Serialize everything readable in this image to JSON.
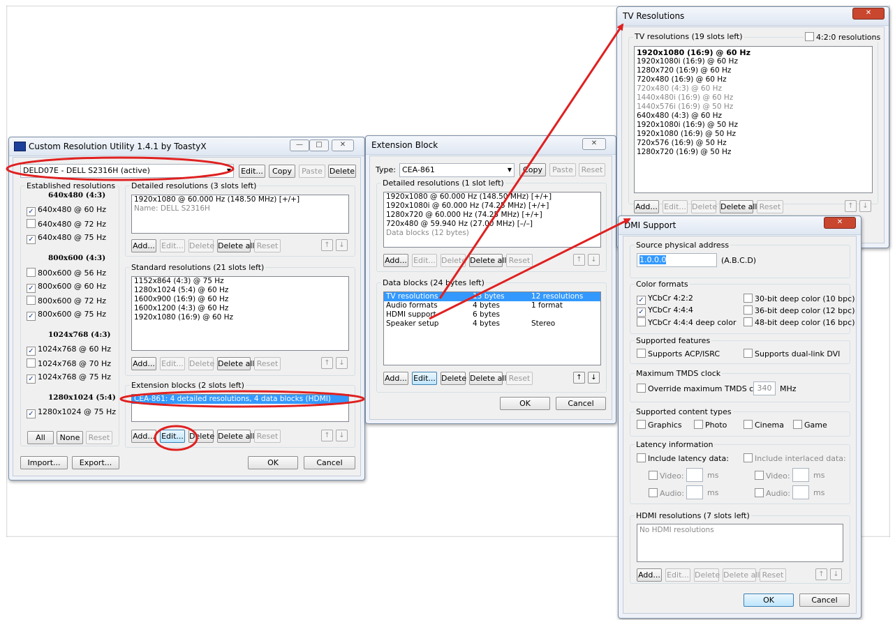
{
  "cru": {
    "title": "Custom Resolution Utility 1.4.1 by ToastyX",
    "monitor": "DELD07E - DELL S2316H (active)",
    "top_buttons": [
      "Edit...",
      "Copy",
      "Paste",
      "Delete"
    ],
    "established_label": "Established resolutions",
    "established_groups": [
      {
        "heading": "640x480 (4:3)",
        "items": [
          [
            "640x480 @ 60 Hz",
            true
          ],
          [
            "640x480 @ 72 Hz",
            false
          ],
          [
            "640x480 @ 75 Hz",
            true
          ]
        ]
      },
      {
        "heading": "800x600 (4:3)",
        "items": [
          [
            "800x600 @ 56 Hz",
            false
          ],
          [
            "800x600 @ 60 Hz",
            true
          ],
          [
            "800x600 @ 72 Hz",
            false
          ],
          [
            "800x600 @ 75 Hz",
            true
          ]
        ]
      },
      {
        "heading": "1024x768 (4:3)",
        "items": [
          [
            "1024x768 @ 60 Hz",
            true
          ],
          [
            "1024x768 @ 70 Hz",
            false
          ],
          [
            "1024x768 @ 75 Hz",
            true
          ]
        ]
      },
      {
        "heading": "1280x1024 (5:4)",
        "items": [
          [
            "1280x1024 @ 75 Hz",
            true
          ]
        ]
      }
    ],
    "est_buttons": [
      "All",
      "None",
      "Reset"
    ],
    "detailed_label": "Detailed resolutions (3 slots left)",
    "detailed_items": [
      "1920x1080 @ 60.000 Hz (148.50 MHz) [+/+]",
      "Name: DELL S2316H"
    ],
    "standard_label": "Standard resolutions (21 slots left)",
    "standard_items": [
      "1152x864 (4:3) @ 75 Hz",
      "1280x1024 (5:4) @ 60 Hz",
      "1600x900 (16:9) @ 60 Hz",
      "1600x1200 (4:3) @ 60 Hz",
      "1920x1080 (16:9) @ 60 Hz"
    ],
    "extension_label": "Extension blocks (2 slots left)",
    "extension_item": "CEA-861: 4 detailed resolutions, 4 data blocks (HDMI)",
    "list_buttons": [
      "Add...",
      "Edit...",
      "Delete",
      "Delete all",
      "Reset"
    ],
    "import": "Import...",
    "export": "Export...",
    "ok": "OK",
    "cancel": "Cancel"
  },
  "ext": {
    "title": "Extension Block",
    "type_label": "Type:",
    "type_value": "CEA-861",
    "type_buttons": [
      "Copy",
      "Paste",
      "Reset"
    ],
    "detailed_label": "Detailed resolutions (1 slot left)",
    "detailed_items": [
      "1920x1080 @ 60.000 Hz (148.50 MHz) [+/+]",
      "1920x1080i @ 60.000 Hz (74.25 MHz) [+/+]",
      "1280x720 @ 60.000 Hz (74.25 MHz) [+/+]",
      "720x480 @ 59.940 Hz (27.00 MHz) [–/–]",
      "Data blocks (12 bytes)"
    ],
    "data_label": "Data blocks (24 bytes left)",
    "data_rows": [
      [
        "TV resolutions",
        "13 bytes",
        "12 resolutions"
      ],
      [
        "Audio formats",
        "4 bytes",
        "1 format"
      ],
      [
        "HDMI support",
        "6 bytes",
        ""
      ],
      [
        "Speaker setup",
        "4 bytes",
        "Stereo"
      ]
    ],
    "list_buttons": [
      "Add...",
      "Edit...",
      "Delete",
      "Delete all",
      "Reset"
    ],
    "ok": "OK",
    "cancel": "Cancel"
  },
  "tv": {
    "title": "TV Resolutions",
    "group_label": "TV resolutions (19 slots left)",
    "ycbcr420": "4:2:0 resolutions",
    "items": [
      {
        "t": "1920x1080 (16:9) @ 60 Hz",
        "s": "bold"
      },
      {
        "t": "1920x1080i (16:9) @ 60 Hz",
        "s": "normal"
      },
      {
        "t": "1280x720 (16:9) @ 60 Hz",
        "s": "normal"
      },
      {
        "t": "720x480 (16:9) @ 60 Hz",
        "s": "normal"
      },
      {
        "t": "720x480 (4:3) @ 60 Hz",
        "s": "gray"
      },
      {
        "t": "1440x480i (16:9) @ 60 Hz",
        "s": "gray"
      },
      {
        "t": "1440x576i (16:9) @ 50 Hz",
        "s": "gray"
      },
      {
        "t": "640x480 (4:3) @ 60 Hz",
        "s": "normal"
      },
      {
        "t": "1920x1080i (16:9) @ 50 Hz",
        "s": "normal"
      },
      {
        "t": "1920x1080 (16:9) @ 50 Hz",
        "s": "normal"
      },
      {
        "t": "720x576 (16:9) @ 50 Hz",
        "s": "normal"
      },
      {
        "t": "1280x720 (16:9) @ 50 Hz",
        "s": "normal"
      }
    ],
    "list_buttons": [
      "Add...",
      "Edit...",
      "Delete",
      "Delete all",
      "Reset"
    ]
  },
  "hdmi": {
    "title": "HDMI Support",
    "title_visible": "DMI Support",
    "spa_label": "Source physical address",
    "spa_value": "1.0.0.0",
    "spa_hint": "(A.B.C.D)",
    "color_label": "Color formats",
    "color_left": [
      [
        "YCbCr 4:2:2",
        true
      ],
      [
        "YCbCr 4:4:4",
        true
      ],
      [
        "YCbCr 4:4:4 deep color",
        false
      ]
    ],
    "color_right": [
      [
        "30-bit deep color (10 bpc)",
        false
      ],
      [
        "36-bit deep color (12 bpc)",
        false
      ],
      [
        "48-bit deep color (16 bpc)",
        false
      ]
    ],
    "features_label": "Supported features",
    "features": [
      "Supports ACP/ISRC",
      "Supports dual-link DVI"
    ],
    "tmds_label": "Maximum TMDS clock",
    "tmds_check": "Override maximum TMDS clock:",
    "tmds_value": "340",
    "tmds_unit": "MHz",
    "content_label": "Supported content types",
    "content": [
      "Graphics",
      "Photo",
      "Cinema",
      "Game"
    ],
    "latency_label": "Latency information",
    "latency_checks": [
      "Include latency data:",
      "Include interlaced data:"
    ],
    "video": "Video:",
    "audio": "Audio:",
    "ms": "ms",
    "hdmi_res_label": "HDMI resolutions (7 slots left)",
    "hdmi_res_empty": "No HDMI resolutions",
    "list_buttons": [
      "Add...",
      "Edit...",
      "Delete",
      "Delete all",
      "Reset"
    ],
    "ok": "OK",
    "cancel": "Cancel"
  },
  "annotation_color": "#e02020"
}
